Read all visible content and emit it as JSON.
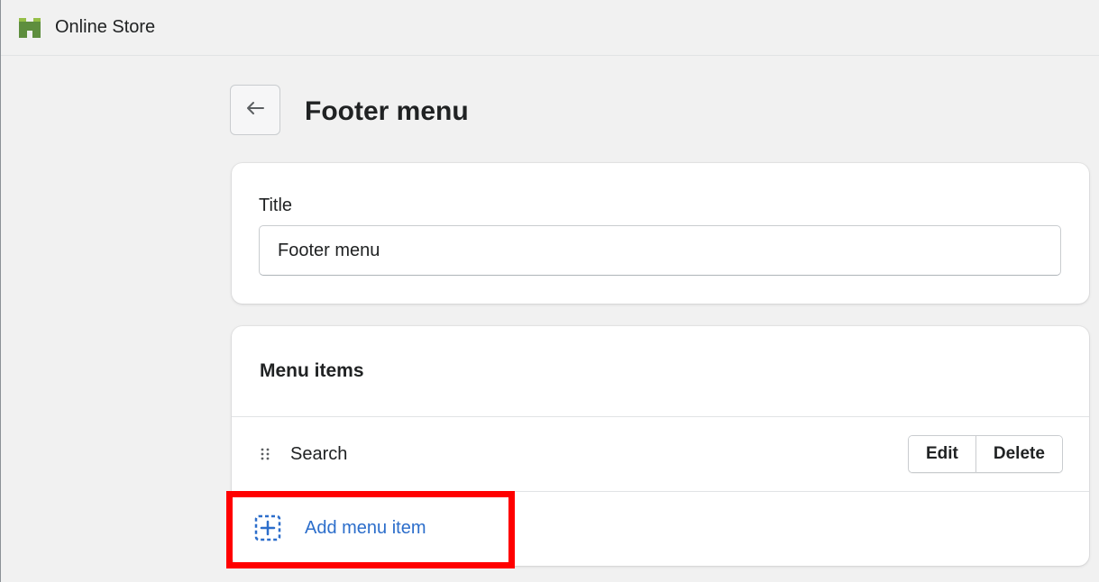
{
  "topbar": {
    "app_name": "Online Store",
    "app_icon": "store-icon",
    "brand_color": "#5e8e3e"
  },
  "page": {
    "title": "Footer menu",
    "back_icon": "arrow-left-icon"
  },
  "title_card": {
    "label": "Title",
    "value": "Footer menu"
  },
  "menu_card": {
    "heading": "Menu items",
    "items": [
      {
        "label": "Search",
        "handle_icon": "drag-handle-icon",
        "edit_label": "Edit",
        "delete_label": "Delete"
      }
    ],
    "add_label": "Add menu item",
    "add_icon": "add-dashed-square-icon",
    "link_color": "#2c6ecb"
  },
  "highlight_color": "#ff0000"
}
